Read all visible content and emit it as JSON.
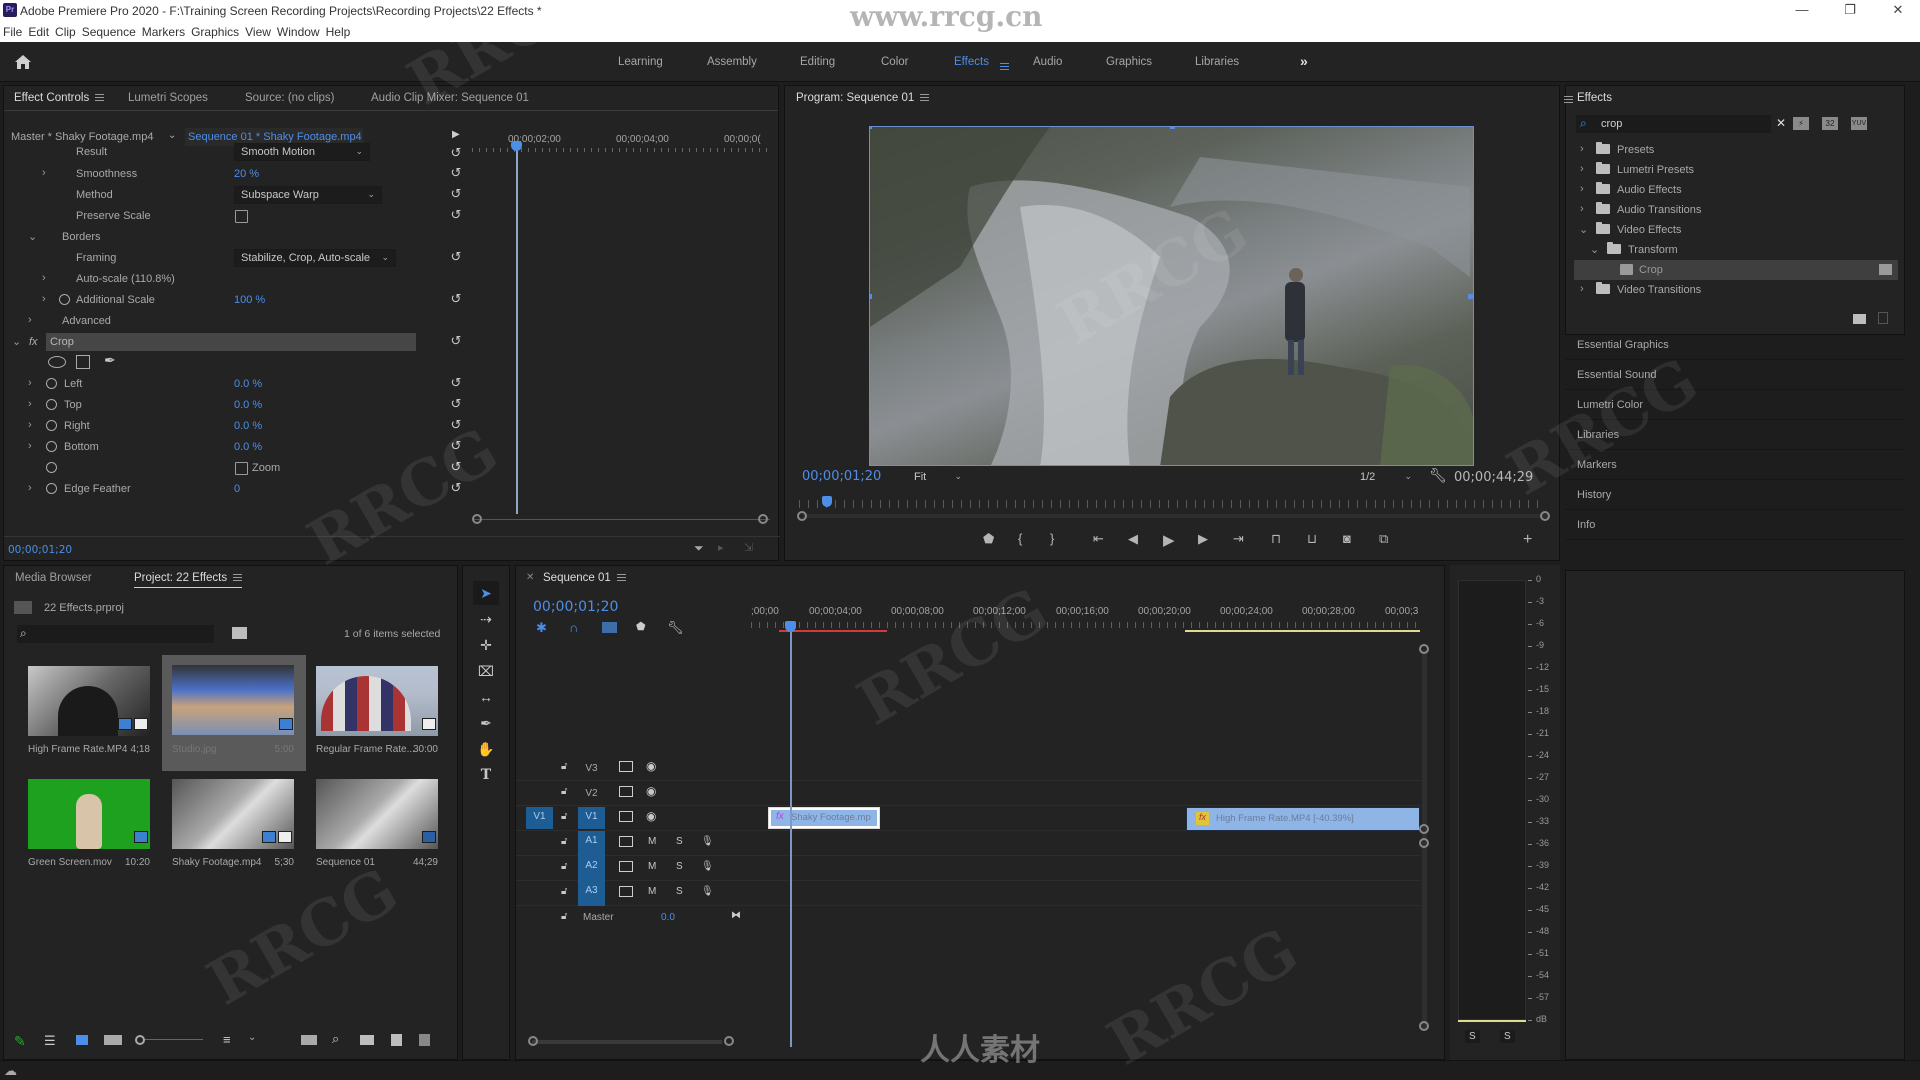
{
  "window": {
    "app_badge": "Pr",
    "title": "Adobe Premiere Pro 2020 - F:\\Training Screen Recording Projects\\Recording Projects\\22 Effects *",
    "controls": {
      "minimize": "—",
      "restore": "❐",
      "close": "✕"
    }
  },
  "menu": [
    "File",
    "Edit",
    "Clip",
    "Sequence",
    "Markers",
    "Graphics",
    "View",
    "Window",
    "Help"
  ],
  "workspaces": {
    "items": [
      "Learning",
      "Assembly",
      "Editing",
      "Color",
      "Effects",
      "Audio",
      "Graphics",
      "Libraries"
    ],
    "active": "Effects",
    "overflow": "»"
  },
  "effect_controls": {
    "tabs": [
      "Effect Controls",
      "Lumetri Scopes",
      "Source: (no clips)",
      "Audio Clip Mixer: Sequence 01"
    ],
    "master_clip": "Master * Shaky Footage.mp4",
    "sequence_clip": "Sequence 01 * Shaky Footage.mp4",
    "ruler_ticks": [
      "00;00;02;00",
      "00;00;04;00",
      "00;00;0("
    ],
    "rows": [
      {
        "label": "Result",
        "type": "dropdown",
        "value": "Smooth Motion"
      },
      {
        "label": "Smoothness",
        "type": "value",
        "value": "20 %"
      },
      {
        "label": "Method",
        "type": "dropdown",
        "value": "Subspace Warp"
      },
      {
        "label": "Preserve Scale",
        "type": "checkbox",
        "checked": false
      },
      {
        "label": "Borders",
        "type": "group"
      },
      {
        "label": "Framing",
        "type": "dropdown",
        "value": "Stabilize, Crop, Auto-scale"
      },
      {
        "label": "Auto-scale (110.8%)",
        "type": "group"
      },
      {
        "label": "Additional Scale",
        "type": "value",
        "value": "100 %"
      },
      {
        "label": "Advanced",
        "type": "group"
      }
    ],
    "crop": {
      "fx_label": "fx",
      "name": "Crop",
      "params": [
        {
          "label": "Left",
          "value": "0.0 %"
        },
        {
          "label": "Top",
          "value": "0.0 %"
        },
        {
          "label": "Right",
          "value": "0.0 %"
        },
        {
          "label": "Bottom",
          "value": "0.0 %"
        }
      ],
      "zoom_label": "Zoom",
      "zoom_checked": false,
      "edge_feather_label": "Edge Feather",
      "edge_feather_value": "0"
    },
    "timecode": "00;00;01;20"
  },
  "program": {
    "title": "Program: Sequence 01",
    "timecode": "00;00;01;20",
    "fit": "Fit",
    "resolution": "1/2",
    "duration": "00;00;44;29",
    "playhead_fraction": 0.037
  },
  "effects_panel": {
    "title": "Effects",
    "search_value": "crop",
    "filter_badges": [
      "⚡",
      "32",
      "YUV"
    ],
    "tree": [
      {
        "label": "Presets",
        "level": 0,
        "expanded": false
      },
      {
        "label": "Lumetri Presets",
        "level": 0,
        "expanded": false
      },
      {
        "label": "Audio Effects",
        "level": 0,
        "expanded": false
      },
      {
        "label": "Audio Transitions",
        "level": 0,
        "expanded": false
      },
      {
        "label": "Video Effects",
        "level": 0,
        "expanded": true
      },
      {
        "label": "Transform",
        "level": 1,
        "expanded": true
      },
      {
        "label": "Crop",
        "level": 2,
        "selected": true
      },
      {
        "label": "Video Transitions",
        "level": 0,
        "expanded": false
      }
    ],
    "collapsed_panels": [
      "Essential Graphics",
      "Essential Sound",
      "Lumetri Color",
      "Libraries",
      "Markers",
      "History",
      "Info"
    ]
  },
  "project": {
    "tabs": [
      "Media Browser",
      "Project: 22 Effects"
    ],
    "file": "22 Effects.prproj",
    "search_placeholder": "",
    "selection_status": "1 of 6 items selected",
    "items": [
      {
        "name": "High Frame Rate.MP4",
        "duration": "4;18",
        "selected": false
      },
      {
        "name": "Studio.jpg",
        "duration": "5:00",
        "selected": true
      },
      {
        "name": "Regular Frame Rate...",
        "duration": "30:00",
        "selected": false
      },
      {
        "name": "Green Screen.mov",
        "duration": "10:20",
        "selected": false
      },
      {
        "name": "Shaky Footage.mp4",
        "duration": "5;30",
        "selected": false
      },
      {
        "name": "Sequence 01",
        "duration": "44;29",
        "selected": false
      }
    ]
  },
  "timeline": {
    "title": "Sequence 01",
    "timecode": "00;00;01;20",
    "ruler_ticks": [
      ";00;00",
      "00;00;04;00",
      "00;00;08;00",
      "00;00;12;00",
      "00;00;16;00",
      "00;00;20;00",
      "00;00;24;00",
      "00;00;28;00",
      "00;00;3"
    ],
    "video_tracks": [
      {
        "name": "V3",
        "source": ""
      },
      {
        "name": "V2",
        "source": ""
      },
      {
        "name": "V1",
        "source": "V1"
      }
    ],
    "audio_tracks": [
      {
        "name": "A1",
        "m": "M",
        "s": "S"
      },
      {
        "name": "A2",
        "m": "M",
        "s": "S"
      },
      {
        "name": "A3",
        "m": "M",
        "s": "S"
      }
    ],
    "master_label": "Master",
    "master_value": "0.0",
    "clips": [
      {
        "label": "Shaky Footage.mp",
        "track": "V1",
        "selected": true
      },
      {
        "label": "High Frame Rate.MP4 [-40.39%]",
        "track": "V1",
        "selected": false
      }
    ]
  },
  "audio_meter": {
    "scale": [
      "0",
      "-3",
      "-6",
      "-9",
      "-12",
      "-15",
      "-18",
      "-21",
      "-24",
      "-27",
      "-30",
      "-33",
      "-36",
      "-39",
      "-42",
      "-45",
      "-48",
      "-51",
      "-54",
      "-57",
      "dB"
    ],
    "solo": [
      "S",
      "S"
    ]
  },
  "watermarks": {
    "site": "www.rrcg.cn",
    "logo": "人人素材",
    "mark": "RRCG"
  }
}
